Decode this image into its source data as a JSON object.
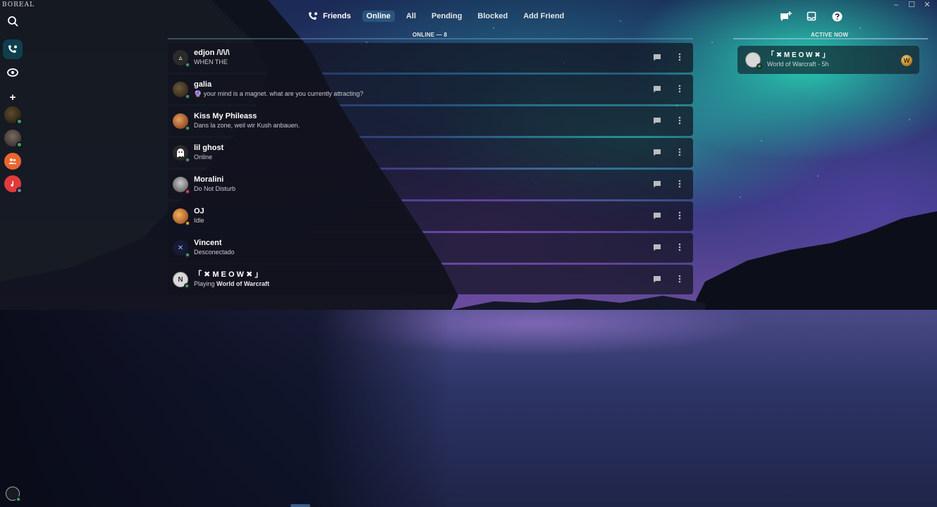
{
  "app": {
    "brand": "BOREAL"
  },
  "window_controls": {
    "minimize": "–",
    "maximize": "☐",
    "close": "✕"
  },
  "rail": {
    "add_label": "+"
  },
  "nav": {
    "title": "Friends",
    "tabs": [
      {
        "label": "Online",
        "active": true
      },
      {
        "label": "All",
        "active": false
      },
      {
        "label": "Pending",
        "active": false
      },
      {
        "label": "Blocked",
        "active": false
      },
      {
        "label": "Add Friend",
        "active": false
      }
    ]
  },
  "list": {
    "section_label": "ONLINE — 8",
    "friends": [
      {
        "name": "edjon /\\/\\/\\",
        "sub": "WHEN THE",
        "status": "online",
        "avatar_color": "#2a2a2a",
        "avatar_glyph": "▵"
      },
      {
        "name": "galia",
        "sub": "🔮 your mind is a magnet. what are you currently attracting?",
        "status": "online",
        "avatar_color": "#3b2e1e",
        "avatar_glyph": ""
      },
      {
        "name": "Kiss My Phileass",
        "sub": "Dans la zone, weil wir Kush anbauen.",
        "status": "online",
        "avatar_color": "#8a3b1c",
        "avatar_glyph": ""
      },
      {
        "name": "lil ghost",
        "sub": "Online",
        "status": "online",
        "avatar_color": "#e8e8e8",
        "avatar_glyph": "👻"
      },
      {
        "name": "Moralini",
        "sub": "Do Not Disturb",
        "status": "dnd",
        "avatar_color": "#6b6b6b",
        "avatar_glyph": ""
      },
      {
        "name": "OJ",
        "sub": "Idle",
        "status": "idle",
        "avatar_color": "#c46a1f",
        "avatar_glyph": ""
      },
      {
        "name": "Vincent",
        "sub": "Desconectado",
        "status": "online",
        "avatar_color": "#1a1f3a",
        "avatar_glyph": "✕"
      },
      {
        "name": "「 ✖ M E O W ✖ 」",
        "sub_prefix": "Playing ",
        "sub_game": "World of Warcraft",
        "status": "online",
        "avatar_color": "#d8d8d8",
        "avatar_glyph": "N"
      }
    ]
  },
  "active_now": {
    "label": "ACTIVE NOW",
    "name": "「 ✖ M E O W ✖ 」",
    "sub": "World of Warcraft - 5h",
    "game_glyph": "W"
  }
}
